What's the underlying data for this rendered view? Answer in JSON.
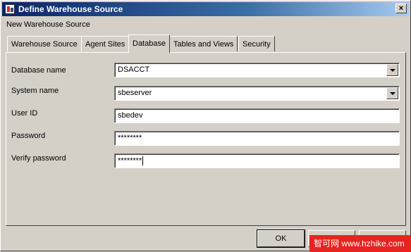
{
  "window": {
    "title": "Define Warehouse Source",
    "close_glyph": "×",
    "icon": "warehouse-app-icon"
  },
  "subtitle": "New Warehouse Source",
  "tabs": [
    {
      "label": "Warehouse Source",
      "active": false
    },
    {
      "label": "Agent Sites",
      "active": false
    },
    {
      "label": "Database",
      "active": true
    },
    {
      "label": "Tables and Views",
      "active": false
    },
    {
      "label": "Security",
      "active": false
    }
  ],
  "form": {
    "database_name": {
      "label": "Database name",
      "value": "DSACCT"
    },
    "system_name": {
      "label": "System name",
      "value": "sbeserver"
    },
    "user_id": {
      "label": "User ID",
      "value": "sbedev"
    },
    "password": {
      "label": "Password",
      "value": "********"
    },
    "verify_password": {
      "label": "Verify password",
      "value": "********"
    }
  },
  "buttons": {
    "ok": "OK"
  },
  "watermark": "智可网 www.hzhike.com",
  "colors": {
    "window_bg": "#d4d0c8",
    "titlebar_start": "#0a246a",
    "titlebar_end": "#a6caf0",
    "watermark_bg": "#e8231f"
  }
}
